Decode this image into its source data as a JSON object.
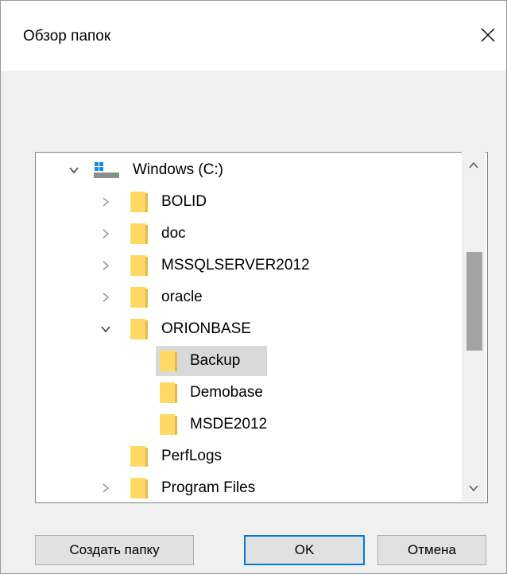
{
  "window": {
    "title": "Обзор папок"
  },
  "tree": {
    "items": [
      {
        "label": "Windows (C:)",
        "expander": "chevron-down-icon",
        "icon": "drive-icon",
        "level": 0
      },
      {
        "label": "BOLID",
        "expander": "chevron-right-icon",
        "icon": "folder-icon",
        "level": 1
      },
      {
        "label": "doc",
        "expander": "chevron-right-icon",
        "icon": "folder-icon",
        "level": 1
      },
      {
        "label": "MSSQLSERVER2012",
        "expander": "chevron-right-icon",
        "icon": "folder-icon",
        "level": 1
      },
      {
        "label": "oracle",
        "expander": "chevron-right-icon",
        "icon": "folder-icon",
        "level": 1
      },
      {
        "label": "ORIONBASE",
        "expander": "chevron-down-icon",
        "icon": "folder-icon",
        "level": 1
      },
      {
        "label": "Backup",
        "expander": "",
        "icon": "folder-icon",
        "level": 2,
        "selected": true
      },
      {
        "label": "Demobase",
        "expander": "",
        "icon": "folder-icon",
        "level": 2
      },
      {
        "label": "MSDE2012",
        "expander": "",
        "icon": "folder-icon",
        "level": 2
      },
      {
        "label": "PerfLogs",
        "expander": "",
        "icon": "folder-icon",
        "level": 1
      },
      {
        "label": "Program Files",
        "expander": "chevron-right-icon",
        "icon": "folder-icon",
        "level": 1
      }
    ]
  },
  "buttons": {
    "new_folder": "Создать папку",
    "ok": "OK",
    "cancel": "Отмена"
  },
  "colors": {
    "selection": "#d9d9d9",
    "folder_fill": "#ffd966",
    "folder_tab": "#e8b84b",
    "focus_border": "#0078d7"
  }
}
